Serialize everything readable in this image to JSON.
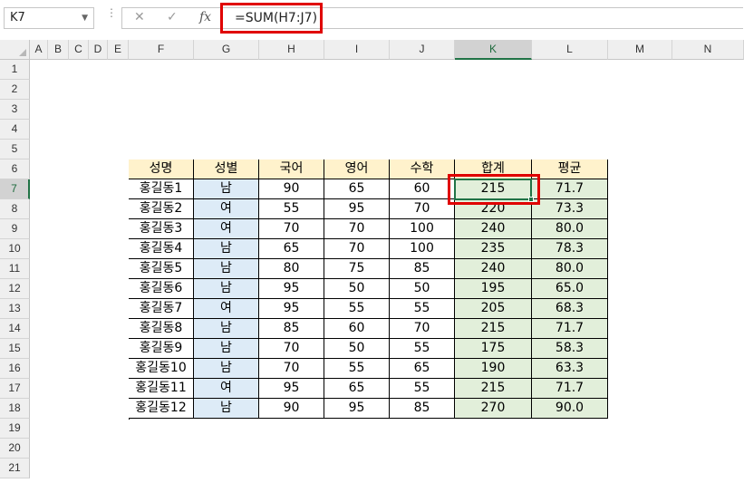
{
  "name_box": "K7",
  "formula": "=SUM(H7:J7)",
  "formula_buttons": {
    "cancel": "✕",
    "enter": "✓",
    "fx": "fx"
  },
  "columns": [
    "A",
    "B",
    "C",
    "D",
    "E",
    "F",
    "G",
    "H",
    "I",
    "J",
    "K",
    "L",
    "M",
    "N"
  ],
  "rows": [
    "1",
    "2",
    "3",
    "4",
    "5",
    "6",
    "7",
    "8",
    "9",
    "10",
    "11",
    "12",
    "13",
    "14",
    "15",
    "16",
    "17",
    "18",
    "19",
    "20",
    "21"
  ],
  "table": {
    "headers": [
      "성명",
      "성별",
      "국어",
      "영어",
      "수학",
      "합계",
      "평균"
    ],
    "data": [
      [
        "홍길동1",
        "남",
        "90",
        "65",
        "60",
        "215",
        "71.7"
      ],
      [
        "홍길동2",
        "여",
        "55",
        "95",
        "70",
        "220",
        "73.3"
      ],
      [
        "홍길동3",
        "여",
        "70",
        "70",
        "100",
        "240",
        "80.0"
      ],
      [
        "홍길동4",
        "남",
        "65",
        "70",
        "100",
        "235",
        "78.3"
      ],
      [
        "홍길동5",
        "남",
        "80",
        "75",
        "85",
        "240",
        "80.0"
      ],
      [
        "홍길동6",
        "남",
        "95",
        "50",
        "50",
        "195",
        "65.0"
      ],
      [
        "홍길동7",
        "여",
        "95",
        "55",
        "55",
        "205",
        "68.3"
      ],
      [
        "홍길동8",
        "남",
        "85",
        "60",
        "70",
        "215",
        "71.7"
      ],
      [
        "홍길동9",
        "남",
        "70",
        "50",
        "55",
        "175",
        "58.3"
      ],
      [
        "홍길동10",
        "남",
        "70",
        "55",
        "65",
        "190",
        "63.3"
      ],
      [
        "홍길동11",
        "여",
        "95",
        "65",
        "55",
        "215",
        "71.7"
      ],
      [
        "홍길동12",
        "남",
        "90",
        "95",
        "85",
        "270",
        "90.0"
      ]
    ]
  },
  "selected_column": "K",
  "selected_row": "7"
}
